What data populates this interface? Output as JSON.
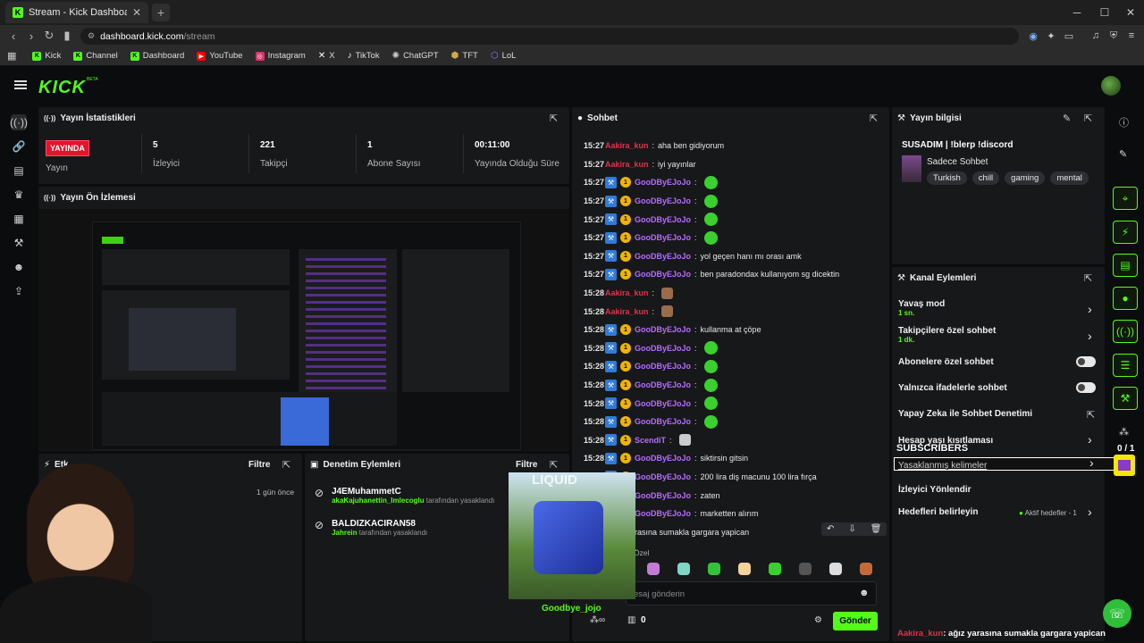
{
  "browser": {
    "tab_title": "Stream - Kick Dashboard",
    "url_host": "dashboard.kick.com",
    "url_path": "/stream",
    "bookmarks": [
      {
        "label": "Kick",
        "color": "#53fc18"
      },
      {
        "label": "Channel",
        "color": "#53fc18"
      },
      {
        "label": "Dashboard",
        "color": "#53fc18"
      },
      {
        "label": "YouTube",
        "color": "#ff0000"
      },
      {
        "label": "Instagram",
        "color": "#e1306c"
      },
      {
        "label": "X",
        "color": "#ffffff"
      },
      {
        "label": "TikTok",
        "color": "#ffffff"
      },
      {
        "label": "ChatGPT",
        "color": "#cccccc"
      },
      {
        "label": "TFT",
        "color": "#d4a84a"
      },
      {
        "label": "LoL",
        "color": "#8a7cff"
      }
    ]
  },
  "app": {
    "logo": "KICK",
    "beta": "BETA",
    "accent": "#53fc18"
  },
  "stats": {
    "title": "Yayın İstatistikleri",
    "live_badge": "YAYINDA",
    "live_label": "Yayın",
    "items": [
      {
        "value": "5",
        "label": "İzleyici"
      },
      {
        "value": "221",
        "label": "Takipçi"
      },
      {
        "value": "1",
        "label": "Abone Sayısı"
      },
      {
        "value": "00:11:00",
        "label": "Yayında Olduğu Süre"
      }
    ]
  },
  "preview": {
    "title": "Yayın Ön İzlemesi"
  },
  "events": {
    "title": "Etk",
    "filter": "Filtre",
    "time": "1 gün önce"
  },
  "moderation": {
    "title": "Denetim Eylemleri",
    "filter": "Filtre",
    "rows": [
      {
        "name": "J4EMuhammetC",
        "by": "akaKajuhanettin_Imlecoglu",
        "suffix": "tarafından yasaklandı"
      },
      {
        "name": "BALDIZKACIRAN58",
        "by": "Jahrein",
        "suffix": "tarafından yasaklandı"
      }
    ]
  },
  "chat": {
    "title": "Sohbet",
    "lines": [
      {
        "time": "15:27",
        "user": "Aakira_kun",
        "type": "red",
        "msg": "aha ben gidiyorum"
      },
      {
        "time": "15:27",
        "user": "Aakira_kun",
        "type": "red",
        "msg": "iyi yayınlar"
      },
      {
        "time": "15:27",
        "user": "GooDByEJoJo",
        "type": "purple",
        "msg": "",
        "emote": "green"
      },
      {
        "time": "15:27",
        "user": "GooDByEJoJo",
        "type": "purple",
        "msg": "",
        "emote": "green"
      },
      {
        "time": "15:27",
        "user": "GooDByEJoJo",
        "type": "purple",
        "msg": "",
        "emote": "green"
      },
      {
        "time": "15:27",
        "user": "GooDByEJoJo",
        "type": "purple",
        "msg": "",
        "emote": "green"
      },
      {
        "time": "15:27",
        "user": "GooDByEJoJo",
        "type": "purple",
        "msg": "yol geçen hanı mı orası amk"
      },
      {
        "time": "15:27",
        "user": "GooDByEJoJo",
        "type": "purple",
        "msg": "ben paradondax kullanıyom sg dicektin"
      },
      {
        "time": "15:28",
        "user": "Aakira_kun",
        "type": "red",
        "msg": "",
        "emote": "brown"
      },
      {
        "time": "15:28",
        "user": "Aakira_kun",
        "type": "red",
        "msg": "",
        "emote": "brown"
      },
      {
        "time": "15:28",
        "user": "GooDByEJoJo",
        "type": "purple",
        "msg": "kullanma at çöpe"
      },
      {
        "time": "15:28",
        "user": "GooDByEJoJo",
        "type": "purple",
        "msg": "",
        "emote": "green"
      },
      {
        "time": "15:28",
        "user": "GooDByEJoJo",
        "type": "purple",
        "msg": "",
        "emote": "green"
      },
      {
        "time": "15:28",
        "user": "GooDByEJoJo",
        "type": "purple",
        "msg": "",
        "emote": "green"
      },
      {
        "time": "15:28",
        "user": "GooDByEJoJo",
        "type": "purple",
        "msg": "",
        "emote": "green"
      },
      {
        "time": "15:28",
        "user": "GooDByEJoJo",
        "type": "purple",
        "msg": "",
        "emote": "green"
      },
      {
        "time": "15:28",
        "user": "ScendiT",
        "type": "purple",
        "msg": "",
        "emote": "gray"
      },
      {
        "time": "15:28",
        "user": "GooDByEJoJo",
        "type": "purple",
        "msg": "siktirsin gitsin"
      },
      {
        "time": "15:28",
        "user": "GooDByEJoJo",
        "type": "purple",
        "msg": "200 lira diş macunu 100 lira fırça"
      },
      {
        "time": "15:28",
        "user": "GooDByEJoJo",
        "type": "purple",
        "msg": "zaten"
      },
      {
        "time": "15:28",
        "user": "GooDByEJoJo",
        "type": "purple",
        "msg": "marketten alırım"
      },
      {
        "time": "",
        "user": "",
        "type": "red",
        "msg": "ağız yarasına sumakla gargara yapican"
      }
    ],
    "emote_tab": "Özel",
    "input_placeholder": "esaj gönderin",
    "points": "0",
    "send": "Gönder"
  },
  "overlay": {
    "label": "Goodbye_jojo",
    "brand": "LIQUID",
    "subscribers": "SUBSCRIBERS",
    "count": "0 / 1",
    "ticker_user": "Aakira_kun",
    "ticker_msg": ": ağız yarasına sumakla gargara yapican"
  },
  "info": {
    "title": "Yayın bilgisi",
    "stream_title": "SUSADIM | !blerp !discord",
    "category": "Sadece Sohbet",
    "tags": [
      "Turkish",
      "chill",
      "gaming",
      "mental"
    ]
  },
  "actions": {
    "title": "Kanal Eylemleri",
    "rows": [
      {
        "label": "Yavaş mod",
        "sub": "1 sn."
      },
      {
        "label": "Takipçilere özel sohbet",
        "sub": "1 dk."
      },
      {
        "label": "Abonelere özel sohbet"
      },
      {
        "label": "Yalnızca ifadelerle sohbet"
      },
      {
        "label": "Yapay Zeka ile Sohbet Denetimi"
      },
      {
        "label": "Hesap yaşı kısıtlaması"
      },
      {
        "label": "Yasaklanmış kelimeler"
      },
      {
        "label": "İzleyici Yönlendir"
      },
      {
        "label": "Hedefleri belirleyin",
        "sub": "Aktif hedefler - 1"
      }
    ]
  }
}
